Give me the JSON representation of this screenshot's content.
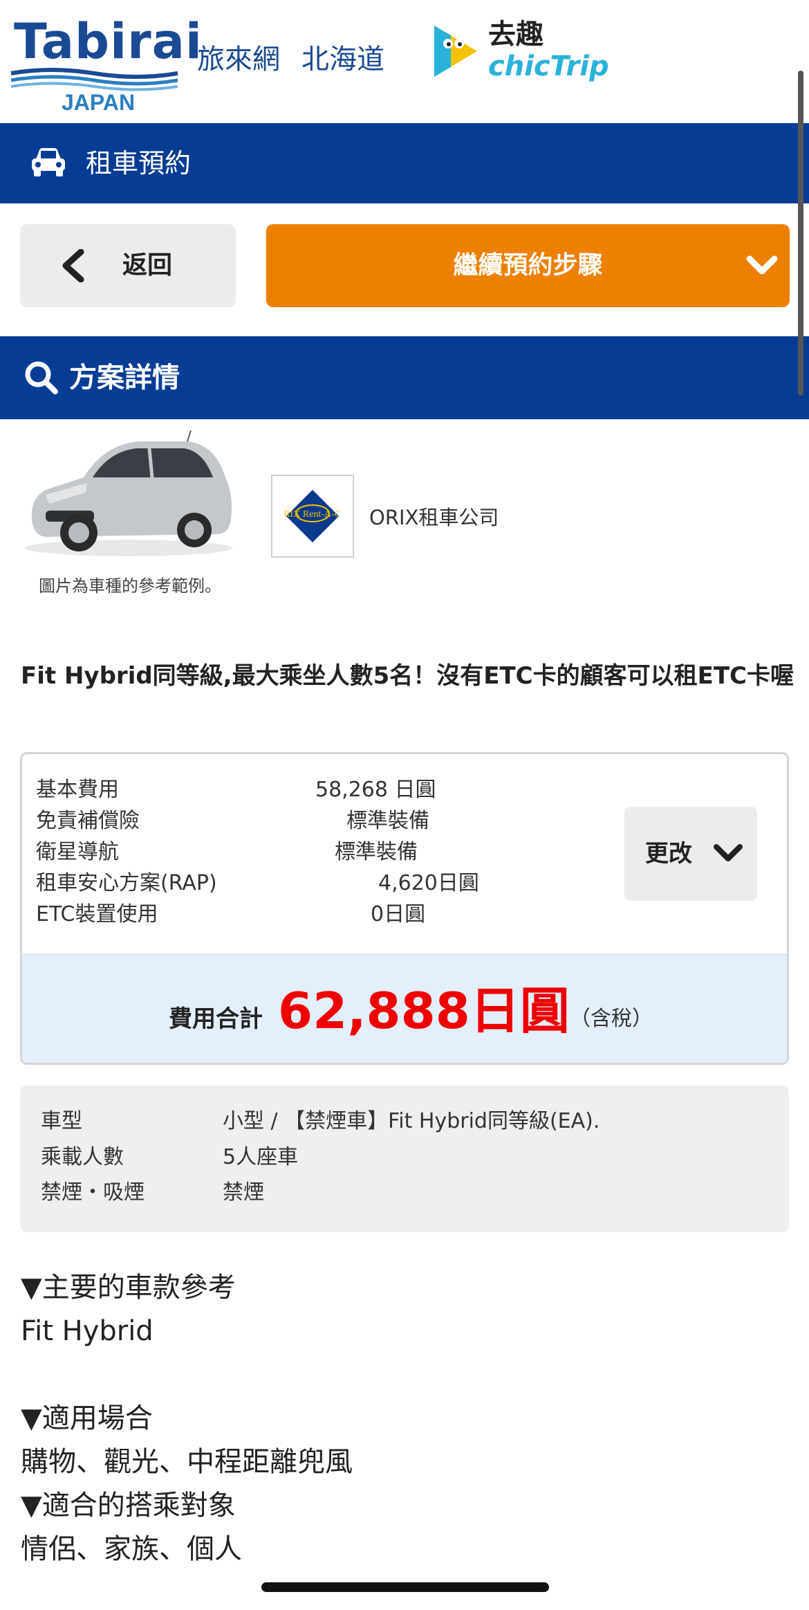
{
  "header": {
    "logo_text": "Tabirai",
    "logo_sub": "JAPAN",
    "link_1": "旅來網",
    "link_2": "北海道",
    "partner_zh": "去趣",
    "partner_en": "chicTrip"
  },
  "rental_bar": {
    "title": "租車預約",
    "icon": "car-icon"
  },
  "actions": {
    "back_label": "返回",
    "continue_label": "繼續預約步驟"
  },
  "plan_bar": {
    "title": "方案詳情",
    "icon": "search-icon"
  },
  "car": {
    "image_caption": "圖片為車種的參考範例。",
    "company_logo_text": "ORIX Rent-A-Car",
    "company_name": "ORIX租車公司"
  },
  "plan_title": "Fit Hybrid同等級,最大乘坐人數5名！沒有ETC卡的顧客可以租ETC卡喔",
  "fees": [
    {
      "label": "基本費用",
      "value": "58,268 日圓"
    },
    {
      "label": "免責補償險",
      "value": "標準裝備"
    },
    {
      "label": "衛星導航",
      "value": "標準裝備"
    },
    {
      "label": "租車安心方案(RAP)",
      "value": "4,620日圓"
    },
    {
      "label": "ETC裝置使用",
      "value": "0日圓"
    }
  ],
  "change_label": "更改",
  "total": {
    "label": "費用合計",
    "amount": "62,888日圓",
    "tax_note": "（含稅）"
  },
  "specs": [
    {
      "label": "車型",
      "value": "小型  /  【禁煙車】Fit Hybrid同等級(EA)."
    },
    {
      "label": "乘載人數",
      "value": "5人座車"
    },
    {
      "label": "禁煙・吸煙",
      "value": "禁煙"
    }
  ],
  "notes": [
    "▼主要的車款參考",
    "Fit Hybrid",
    "",
    "▼適用場合",
    "購物、觀光、中程距離兜風",
    "▼適合的搭乘對象",
    "情侶、家族、個人"
  ],
  "colors": {
    "navy": "#063c93",
    "orange": "#ee8001",
    "price_red": "#ee0000",
    "total_band": "#e3effb"
  }
}
